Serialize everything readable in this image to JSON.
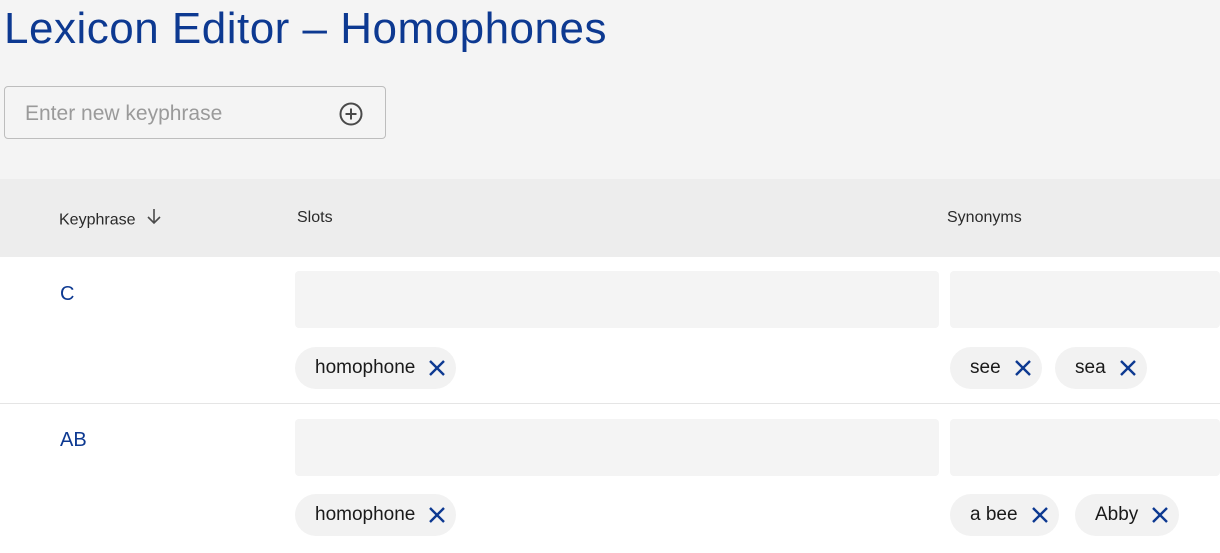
{
  "title": "Lexicon Editor – Homophones",
  "new_keyphrase": {
    "placeholder": "Enter new keyphrase",
    "value": ""
  },
  "columns": {
    "keyphrase": "Keyphrase",
    "slots": "Slots",
    "synonyms": "Synonyms"
  },
  "sort": {
    "column": "keyphrase",
    "direction": "descending"
  },
  "rows": [
    {
      "keyphrase": "C",
      "slots": [
        "homophone"
      ],
      "synonyms": [
        "see",
        "sea"
      ]
    },
    {
      "keyphrase": "AB",
      "slots": [
        "homophone"
      ],
      "synonyms": [
        "a bee",
        "Abby"
      ]
    }
  ],
  "colors": {
    "accent": "#0d3991",
    "header_bg": "#ededed",
    "chip_bg": "#f2f2f2"
  },
  "icons": {
    "add": "plus-circle-icon",
    "sort": "arrow-down-icon",
    "remove": "close-icon"
  }
}
